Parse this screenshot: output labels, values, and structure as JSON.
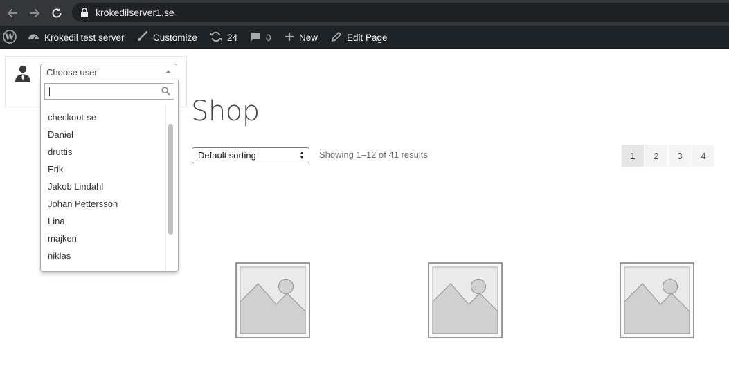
{
  "browser": {
    "url": "krokedilserver1.se"
  },
  "admin_bar": {
    "site_name": "Krokedil test server",
    "customize": "Customize",
    "updates_count": "24",
    "comments_count": "0",
    "new": "New",
    "edit_page": "Edit Page"
  },
  "user_switcher": {
    "placeholder": "Choose user",
    "search_value": "",
    "users": [
      "checkout-se",
      "Daniel",
      "druttis",
      "Erik",
      "Jakob Lindahl",
      "Johan Pettersson",
      "Lina",
      "majken",
      "niklas"
    ]
  },
  "shop": {
    "title": "Shop",
    "sorting": "Default sorting",
    "result_count": "Showing 1–12 of 41 results",
    "pages": [
      "1",
      "2",
      "3",
      "4"
    ],
    "current_page": "1"
  },
  "colors": {
    "admin_bar_bg": "#1d2327",
    "browser_bar_bg": "#35363a",
    "url_bar_bg": "#202124"
  }
}
